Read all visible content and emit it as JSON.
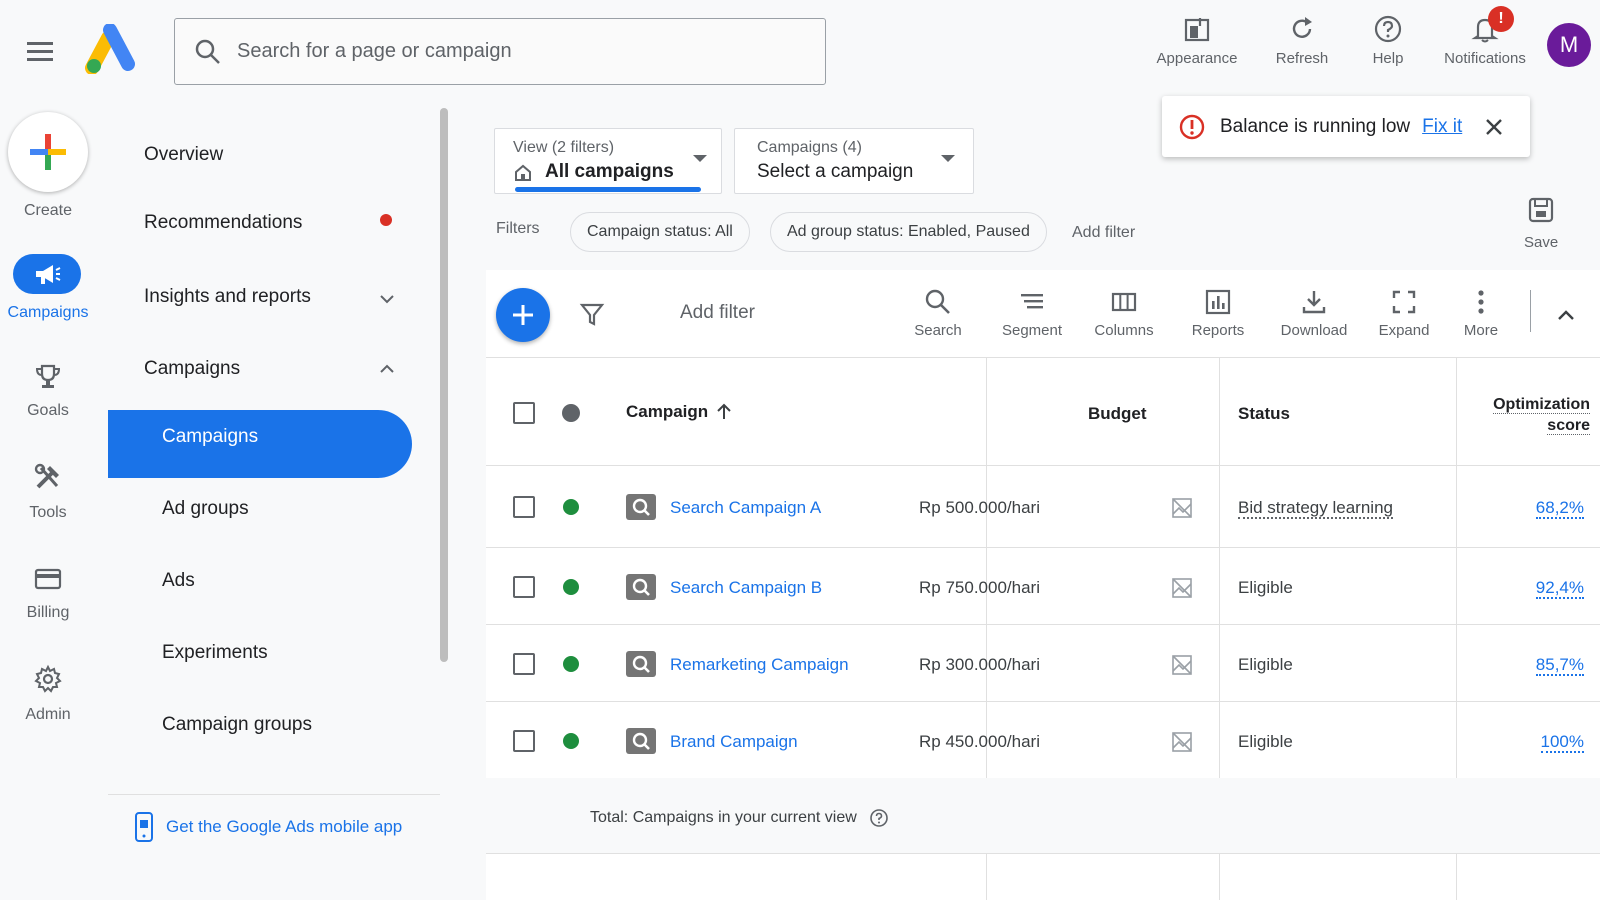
{
  "header": {
    "search_placeholder": "Search for a page or campaign",
    "tools": [
      {
        "label": "Appearance",
        "icon": "appearance-icon"
      },
      {
        "label": "Refresh",
        "icon": "refresh-icon"
      },
      {
        "label": "Help",
        "icon": "help-icon"
      },
      {
        "label": "Notifications",
        "icon": "bell-icon"
      }
    ],
    "notification_badge": "!",
    "avatar_letter": "M"
  },
  "rail": {
    "create": "Create",
    "items": [
      {
        "label": "Campaigns",
        "icon": "megaphone-icon",
        "active": true
      },
      {
        "label": "Goals",
        "icon": "trophy-icon"
      },
      {
        "label": "Tools",
        "icon": "tools-icon"
      },
      {
        "label": "Billing",
        "icon": "credit-card-icon"
      },
      {
        "label": "Admin",
        "icon": "gear-icon"
      }
    ]
  },
  "sidenav": {
    "overview": "Overview",
    "recommendations": "Recommendations",
    "insights": "Insights and reports",
    "campaigns_group": "Campaigns",
    "sub_items": [
      "Campaigns",
      "Ad groups",
      "Ads",
      "Experiments",
      "Campaign groups"
    ],
    "mobile_app": "Get the Google Ads mobile app"
  },
  "view_selector": {
    "small": "View (2 filters)",
    "big": "All campaigns"
  },
  "campaign_selector": {
    "small": "Campaigns (4)",
    "big": "Select a campaign"
  },
  "filters": {
    "label": "Filters",
    "chips": [
      "Campaign status: All",
      "Ad group status: Enabled, Paused"
    ],
    "add_filter": "Add filter"
  },
  "save_label": "Save",
  "toast": {
    "message": "Balance is running low",
    "link": "Fix it"
  },
  "toolbar": {
    "add_filter": "Add filter",
    "tools": [
      {
        "label": "Search",
        "icon": "search-icon"
      },
      {
        "label": "Segment",
        "icon": "segment-icon"
      },
      {
        "label": "Columns",
        "icon": "columns-icon"
      },
      {
        "label": "Reports",
        "icon": "reports-icon"
      },
      {
        "label": "Download",
        "icon": "download-icon"
      },
      {
        "label": "Expand",
        "icon": "expand-icon"
      },
      {
        "label": "More",
        "icon": "more-vert-icon"
      }
    ]
  },
  "table": {
    "headers": {
      "campaign": "Campaign",
      "budget": "Budget",
      "status": "Status",
      "opt_line1": "Optimization",
      "opt_line2": "score"
    },
    "rows": [
      {
        "campaign": "Search Campaign A",
        "budget": "Rp 500.000/hari",
        "status": "Bid strategy learning",
        "optimization": "68,2%"
      },
      {
        "campaign": "Search Campaign B",
        "budget": "Rp 750.000/hari",
        "status": "Eligible",
        "optimization": "92,4%"
      },
      {
        "campaign": "Remarketing Campaign",
        "budget": "Rp 300.000/hari",
        "status": "Eligible",
        "optimization": "85,7%"
      },
      {
        "campaign": "Brand Campaign",
        "budget": "Rp 450.000/hari",
        "status": "Eligible",
        "optimization": "100%"
      }
    ],
    "total": "Total: Campaigns in your current view"
  },
  "colors": {
    "accent": "#1a73e8",
    "enabled": "#1e8e3e",
    "alert": "#d93025"
  }
}
